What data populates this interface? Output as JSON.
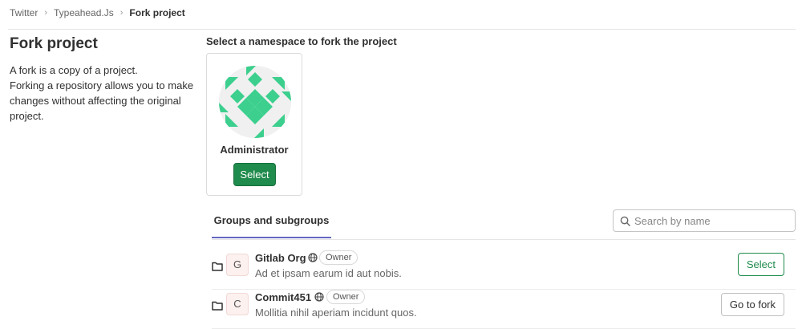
{
  "breadcrumb": {
    "items": [
      "Twitter",
      "Typeahead.Js",
      "Fork project"
    ]
  },
  "left": {
    "title": "Fork project",
    "line1": "A fork is a copy of a project.",
    "line2": "Forking a repository allows you to make changes without affecting the original project."
  },
  "namespace": {
    "heading": "Select a namespace to fork the project",
    "card": {
      "name": "Administrator",
      "select_label": "Select",
      "avatar_color": "#3ccf8e"
    }
  },
  "groups": {
    "tab_label": "Groups and subgroups",
    "search_placeholder": "Search by name",
    "rows": [
      {
        "initial": "G",
        "name": "Gitlab Org",
        "badge": "Owner",
        "description": "Ad et ipsam earum id aut nobis.",
        "action_label": "Select"
      },
      {
        "initial": "C",
        "name": "Commit451",
        "badge": "Owner",
        "description": "Mollitia nihil aperiam incidunt quos.",
        "action_label": "Go to fork"
      }
    ]
  },
  "colors": {
    "primary": "#1f8b4c",
    "tab_underline": "#6666c4"
  },
  "icons": [
    "chevron-right-icon",
    "search-icon",
    "folder-icon",
    "globe-icon"
  ]
}
